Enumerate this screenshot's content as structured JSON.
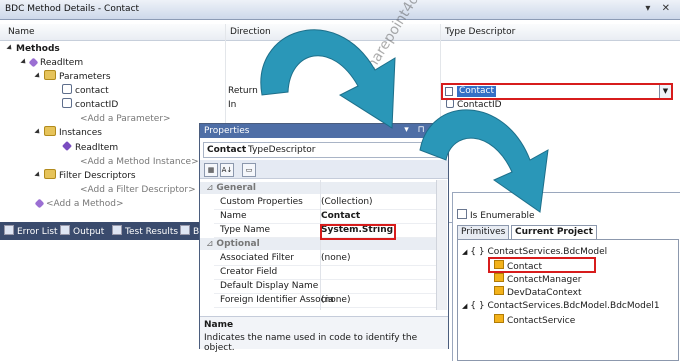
{
  "bdc": {
    "title": "BDC Method Details - Contact",
    "window_buttons": "▾ ✕",
    "columns": {
      "name": "Name",
      "direction": "Direction",
      "type_descriptor": "Type Descriptor"
    },
    "tree": {
      "methods": "Methods",
      "readitem": "ReadItem",
      "parameters": "Parameters",
      "contact": "contact",
      "contact_direction": "Return",
      "contactid": "contactID",
      "contactid_direction": "In",
      "contactid_descriptor": "ContactID",
      "add_parameter": "<Add a Parameter>",
      "instances": "Instances",
      "readitem_instance": "ReadItem",
      "add_instance": "<Add a Method Instance>",
      "filter_descriptors": "Filter Descriptors",
      "add_filter": "<Add a Filter Descriptor>",
      "add_method": "<Add a Method>"
    },
    "selected_type_descriptor": "Contact"
  },
  "bottom_tabs": [
    "Error List",
    "Output",
    "Test Results",
    "B"
  ],
  "properties": {
    "title": "Properties",
    "title_buttons": "▾ ⊓ ✕",
    "object_name": "Contact",
    "object_type": "TypeDescriptor",
    "toolbar": {
      "categorized": "▦",
      "alphabetical": "A↓",
      "pages": "▭"
    },
    "categories": {
      "general": "General",
      "optional": "Optional"
    },
    "rows": [
      {
        "key": "Custom Properties",
        "value": "(Collection)"
      },
      {
        "key": "Name",
        "value": "Contact"
      },
      {
        "key": "Type Name",
        "value": "System.String"
      },
      {
        "key": "Associated Filter",
        "value": "(none)"
      },
      {
        "key": "Creator Field",
        "value": ""
      },
      {
        "key": "Default Display Name",
        "value": ""
      },
      {
        "key": "Foreign Identifier Associa",
        "value": "(none)"
      }
    ],
    "description_title": "Name",
    "description_text": "Indicates the name used in code to identify the object."
  },
  "class_view": {
    "is_enumerable": "Is Enumerable",
    "tabs": [
      "Primitives",
      "Current Project"
    ],
    "tree": [
      {
        "label": "ContactServices.BdcModel",
        "level": 0
      },
      {
        "label": "Contact",
        "level": 1
      },
      {
        "label": "ContactManager",
        "level": 1
      },
      {
        "label": "DevDataContext",
        "level": 1
      },
      {
        "label": "ContactServices.BdcModel.BdcModel1",
        "level": 0
      },
      {
        "label": "ContactService",
        "level": 1
      }
    ]
  },
  "watermark": "sharepoint4developers.net",
  "colors": {
    "highlight_border": "#d71c1c",
    "arrow": "#2a97b8",
    "selection": "#3470c6"
  }
}
